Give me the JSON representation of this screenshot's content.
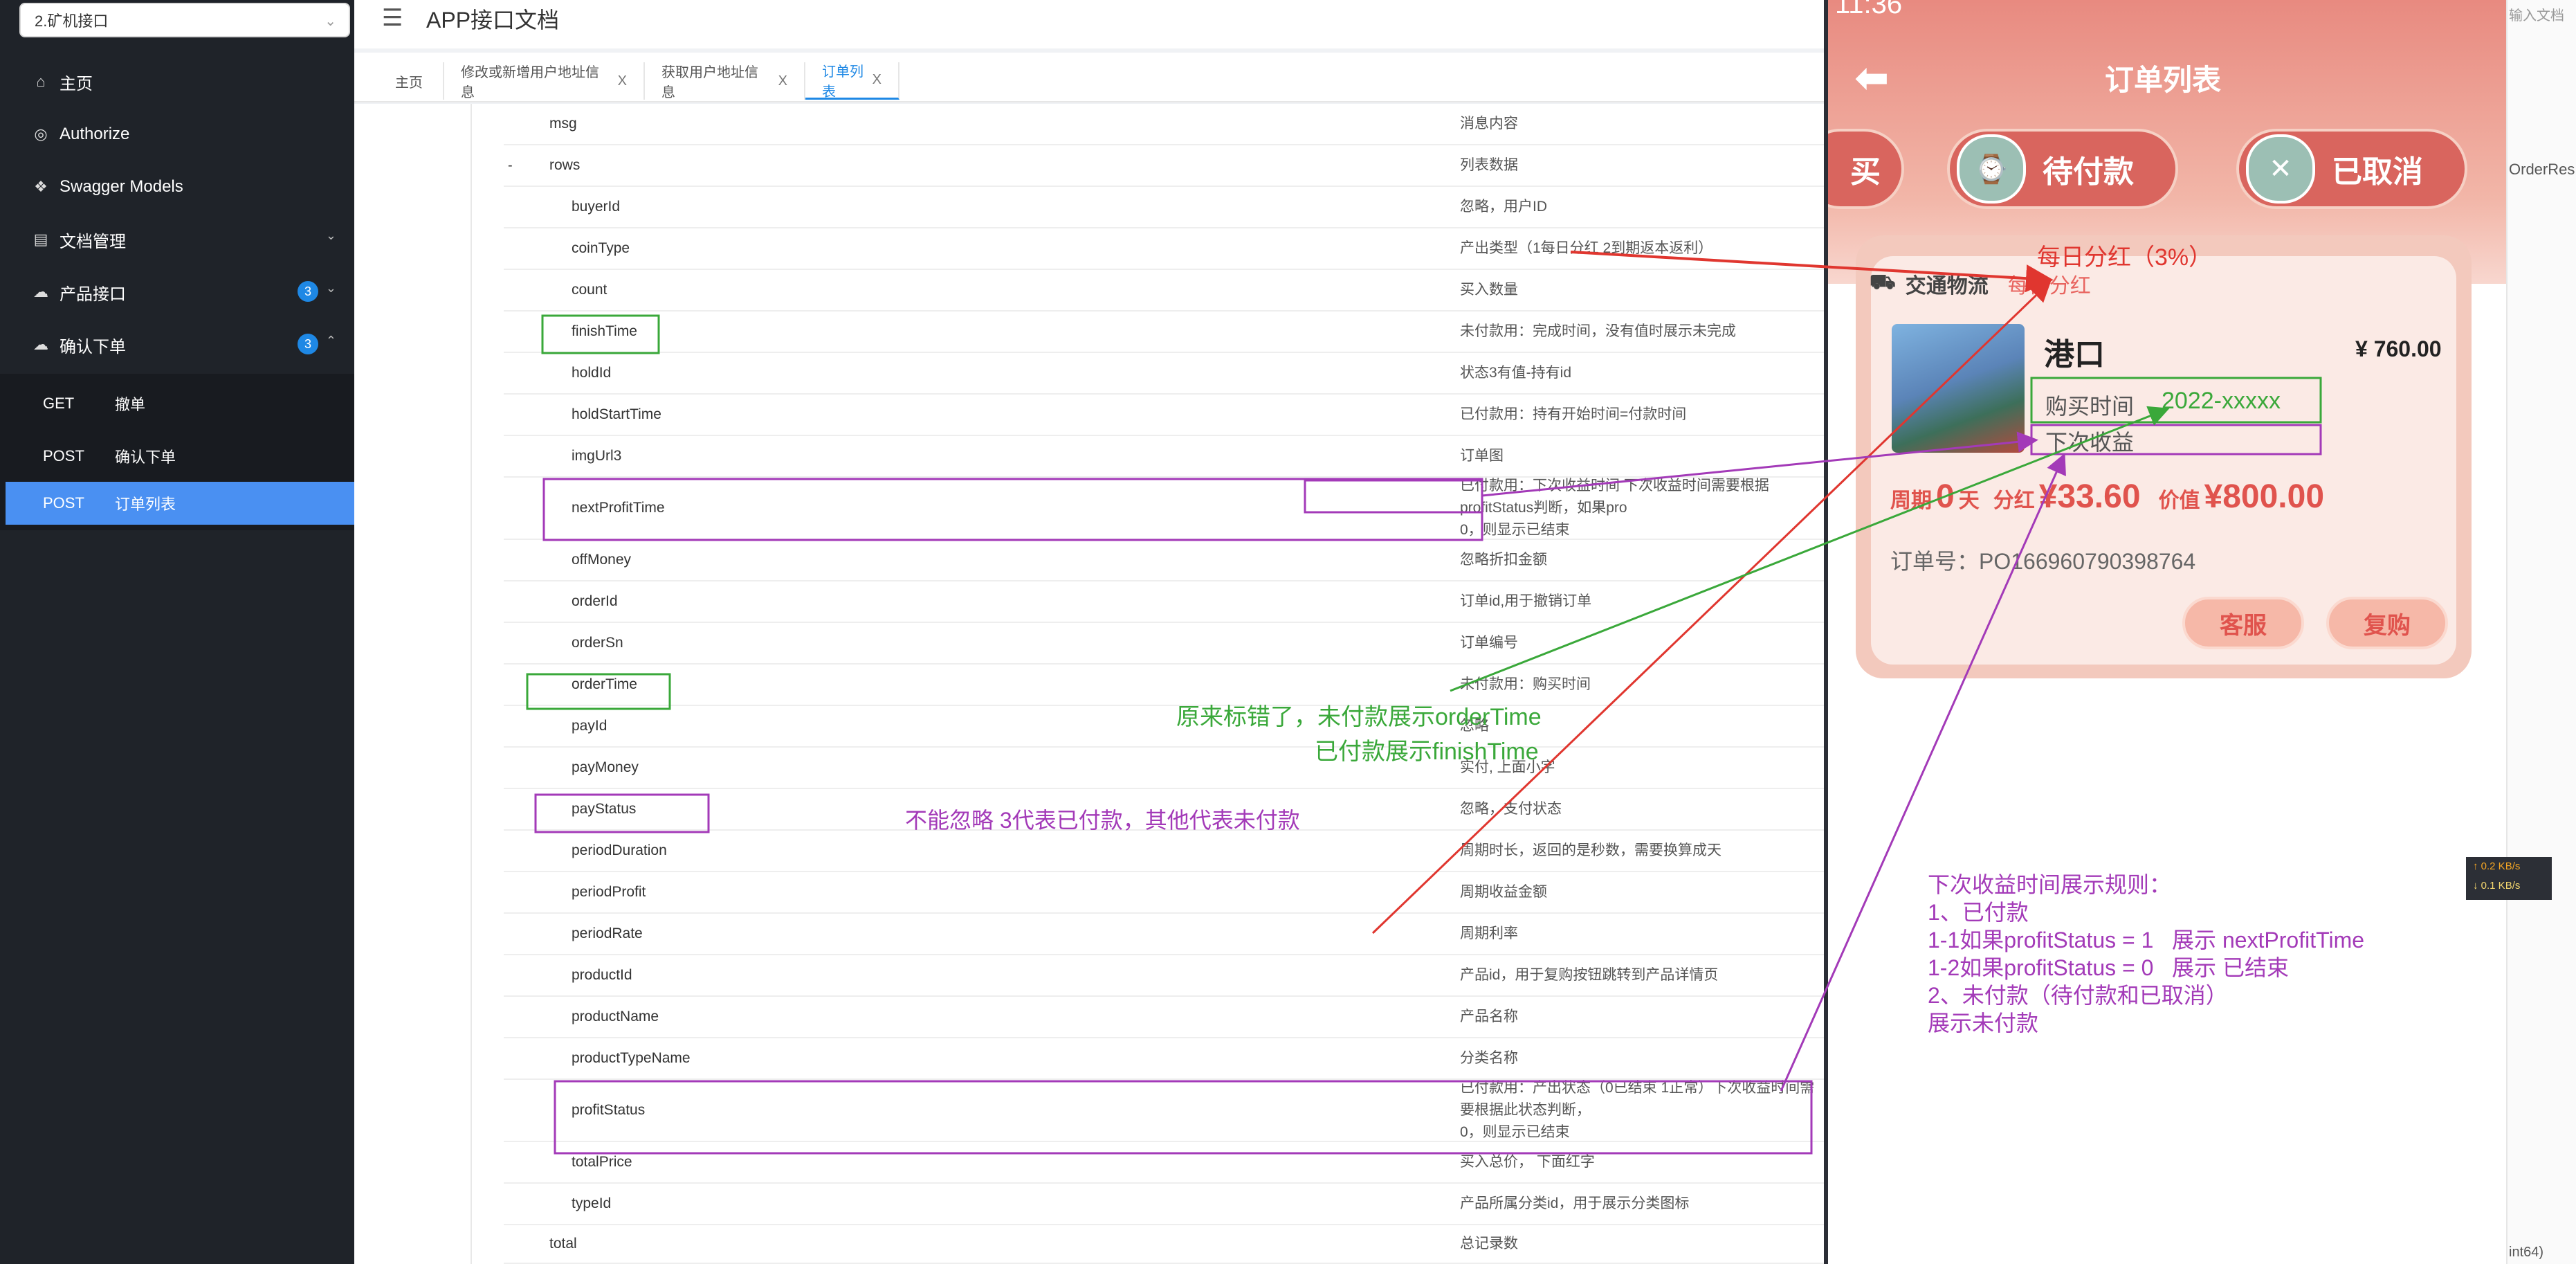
{
  "sidebar": {
    "group_select": "2.矿机接口",
    "items": [
      {
        "label": "主页"
      },
      {
        "label": "Authorize"
      },
      {
        "label": "Swagger Models"
      },
      {
        "label": "文档管理"
      },
      {
        "label": "产品接口",
        "badge": "3"
      },
      {
        "label": "确认下单",
        "badge": "3"
      }
    ],
    "sub_items": [
      {
        "method": "GET",
        "label": "撤单"
      },
      {
        "method": "POST",
        "label": "确认下单"
      },
      {
        "method": "POST",
        "label": "订单列表"
      }
    ]
  },
  "header": {
    "title": "APP接口文档"
  },
  "tabs": [
    {
      "label": "主页"
    },
    {
      "label": "修改或新增用户地址信息",
      "close": "X"
    },
    {
      "label": "获取用户地址信息",
      "close": "X"
    },
    {
      "label": "订单列表",
      "close": "X"
    }
  ],
  "rows": [
    {
      "name": "msg",
      "desc": "消息内容"
    },
    {
      "name": "rows",
      "desc": "列表数据",
      "toggle": "-"
    },
    {
      "name": "buyerId",
      "desc": "忽略，用户ID"
    },
    {
      "name": "coinType",
      "desc": "产出类型（1每日分红 2到期返本返利）"
    },
    {
      "name": "count",
      "desc": "买入数量"
    },
    {
      "name": "finishTime",
      "desc": "未付款用：完成时间，没有值时展示未完成"
    },
    {
      "name": "holdId",
      "desc": "状态3有值-持有id"
    },
    {
      "name": "holdStartTime",
      "desc": "已付款用：持有开始时间=付款时间"
    },
    {
      "name": "imgUrl3",
      "desc": "订单图"
    },
    {
      "name": "nextProfitTime",
      "desc": "已付款用：下次收益时间  下次收益时间需要根据profitStatus判断，如果pro\n0，则显示已结束"
    },
    {
      "name": "offMoney",
      "desc": "忽略折扣金额"
    },
    {
      "name": "orderId",
      "desc": "订单id,用于撤销订单"
    },
    {
      "name": "orderSn",
      "desc": "订单编号"
    },
    {
      "name": "orderTime",
      "desc": "未付款用：购买时间"
    },
    {
      "name": "payId",
      "desc": "忽略"
    },
    {
      "name": "payMoney",
      "desc": "实付, 上面小字"
    },
    {
      "name": "payStatus",
      "desc": "忽略，支付状态"
    },
    {
      "name": "periodDuration",
      "desc": "周期时长，返回的是秒数，需要换算成天"
    },
    {
      "name": "periodProfit",
      "desc": "周期收益金额"
    },
    {
      "name": "periodRate",
      "desc": "周期利率"
    },
    {
      "name": "productId",
      "desc": "产品id，用于复购按钮跳转到产品详情页"
    },
    {
      "name": "productName",
      "desc": "产品名称"
    },
    {
      "name": "productTypeName",
      "desc": "分类名称"
    },
    {
      "name": "profitStatus",
      "desc": "已付款用：产出状态（0已结束 1正常）下次收益时间需要根据此状态判断，\n0，则显示已结束"
    },
    {
      "name": "totalPrice",
      "desc": "买入总价，  下面红字"
    },
    {
      "name": "typeId",
      "desc": "产品所属分类id，用于展示分类图标"
    },
    {
      "name": "total",
      "desc": "总记录数"
    }
  ],
  "phone": {
    "status_time": "11:36",
    "title": "订单列表",
    "tabs": [
      {
        "label": "买"
      },
      {
        "label": "待付款"
      },
      {
        "label": "已取消"
      }
    ],
    "card": {
      "category": "交通物流",
      "coin_type": "每日分红",
      "product_name": "港口",
      "price": "¥ 760.00",
      "buy_time_label": "购买时间",
      "next_profit_label": "下次收益",
      "period_prefix": "周期",
      "period_days": "0",
      "period_suffix": "天",
      "dividend_label": "分红",
      "dividend": "¥33.60",
      "value_label": "价值",
      "value": "¥800.00",
      "order_no": "订单号：PO166960790398764",
      "btn_service": "客服",
      "btn_rebuy": "复购"
    }
  },
  "right_strip": {
    "top_text": "输入文档",
    "mid_text": "OrderRes",
    "bottom_text": "int64)"
  },
  "net_speed": {
    "up": "↑ 0.2 KB/s",
    "down": "↓ 0.1 KB/s"
  },
  "annotations": {
    "daily_dividend": "每日分红（3%）",
    "buy_time_value": "2022-xxxxx",
    "mislabeled_line1": "原来标错了，未付款展示orderTime",
    "mislabeled_line2": "已付款展示finishTime",
    "pay_status_note": "不能忽略 3代表已付款，其他代表未付款",
    "rules": [
      "下次收益时间展示规则：",
      "1、已付款",
      "1-1如果profitStatus = 1   展示 nextProfitTime",
      "1-2如果profitStatus = 0   展示 已结束",
      "",
      "2、未付款（待付款和已取消）",
      "展示未付款"
    ]
  },
  "colors": {
    "sidebar_bg": "#1f2329",
    "active_blue": "#4a90f2",
    "annot_green": "#3aa83a",
    "annot_purple": "#a33ab8",
    "annot_red": "#e0362f"
  }
}
